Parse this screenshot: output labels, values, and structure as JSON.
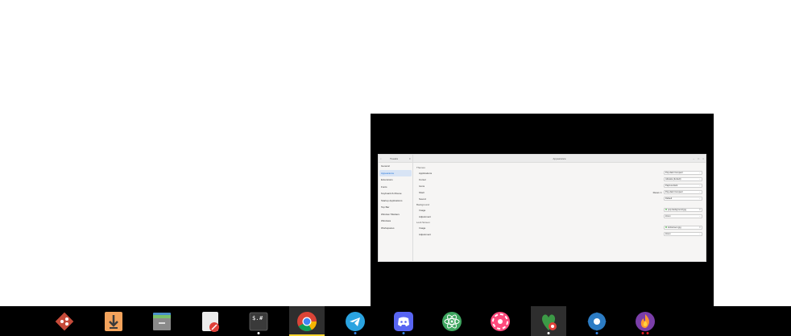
{
  "window": {
    "sidebar_title": "Tweaks",
    "main_title": "Appearance",
    "sidebar_items": [
      {
        "label": "General"
      },
      {
        "label": "Appearance",
        "active": true
      },
      {
        "label": "Extensions"
      },
      {
        "label": "Fonts"
      },
      {
        "label": "Keyboard & Mouse"
      },
      {
        "label": "Startup Applications"
      },
      {
        "label": "Top Bar"
      },
      {
        "label": "Window Titlebars"
      },
      {
        "label": "Windows"
      },
      {
        "label": "Workspaces"
      }
    ],
    "themes_header": "Themes",
    "themes": [
      {
        "label": "Applications",
        "value": "Pop-dark Compact"
      },
      {
        "label": "Cursor",
        "value": "Adwaita (default)"
      },
      {
        "label": "Icons",
        "value": "Papirus-Dark"
      },
      {
        "label": "Shell",
        "value": "Pop-dark Compact",
        "reset": "Reset"
      },
      {
        "label": "Sound",
        "value": "Default"
      }
    ],
    "background_header": "Background",
    "background": [
      {
        "label": "Image",
        "value": "pop-background.jpg"
      },
      {
        "label": "Adjustment",
        "value": "Zoom"
      }
    ],
    "lockscreen_header": "Lock Screen",
    "lockscreen": [
      {
        "label": "Image",
        "value": "lockscreen.jpg"
      },
      {
        "label": "Adjustment",
        "value": "Zoom"
      }
    ]
  },
  "dock": {
    "apps": [
      {
        "name": "git-client",
        "color": "#c64b3a"
      },
      {
        "name": "downloader",
        "color": "#f0a050"
      },
      {
        "name": "archive-manager",
        "color": "#7d7d7d"
      },
      {
        "name": "text-editor",
        "color": "#e8e8e8"
      },
      {
        "name": "terminal",
        "color": "#3a3a3a"
      },
      {
        "name": "chrome",
        "color": "#4285f4"
      },
      {
        "name": "telegram",
        "color": "#2aa3e0"
      },
      {
        "name": "discord",
        "color": "#5865f2"
      },
      {
        "name": "atom",
        "color": "#3fa660"
      },
      {
        "name": "screenshot-tool",
        "color": "#ff4a7d"
      },
      {
        "name": "tweaks",
        "color": "#3c9a46"
      },
      {
        "name": "settings",
        "color": "#2c7cc4"
      },
      {
        "name": "hydrogen",
        "color": "#7a3ea8"
      }
    ]
  }
}
